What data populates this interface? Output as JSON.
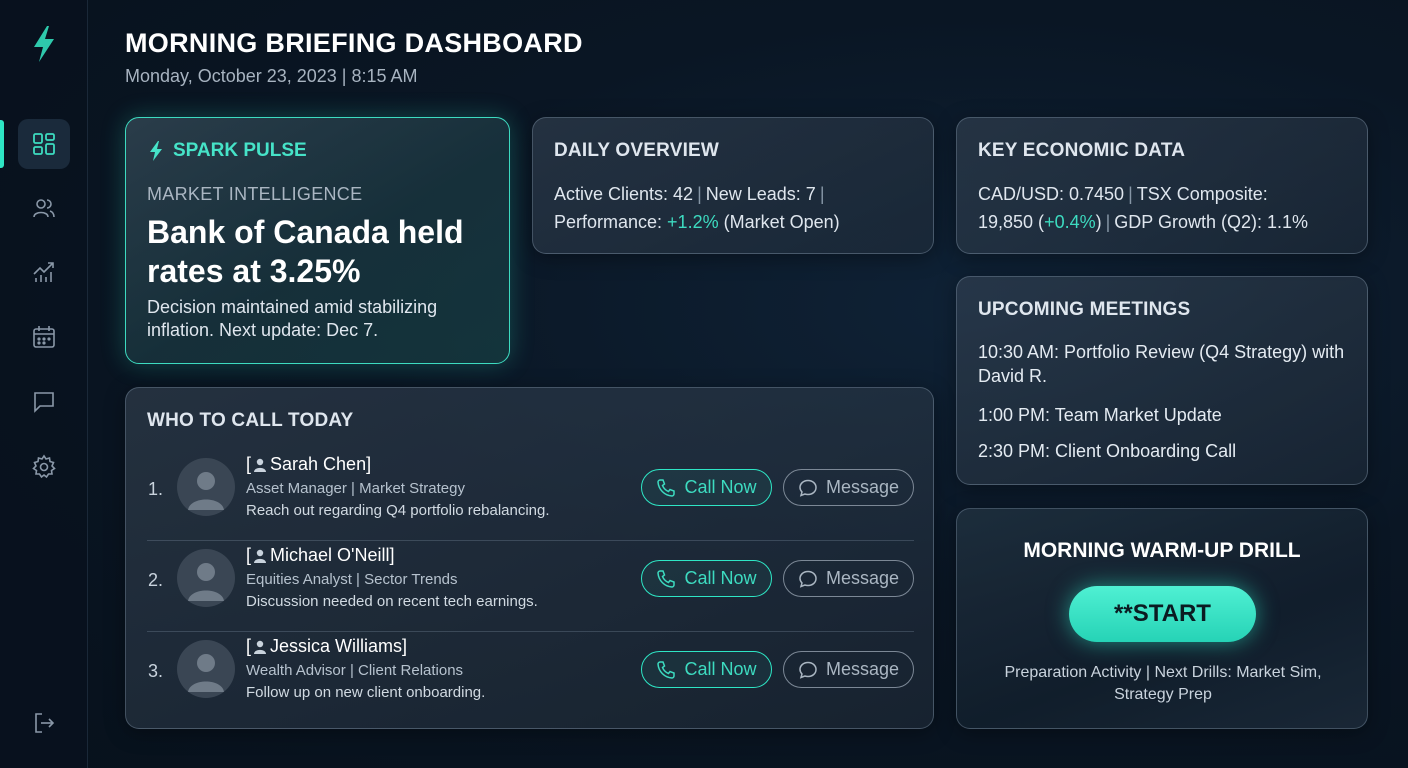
{
  "header": {
    "title": "MORNING BRIEFING DASHBOARD",
    "date": "Monday, October 23, 2023 | 8:15 AM"
  },
  "sidebar": {
    "items": [
      {
        "name": "dashboard",
        "icon": "grid-icon",
        "active": true
      },
      {
        "name": "clients",
        "icon": "users-icon",
        "active": false
      },
      {
        "name": "analytics",
        "icon": "chart-icon",
        "active": false
      },
      {
        "name": "calendar",
        "icon": "calendar-icon",
        "active": false
      },
      {
        "name": "messages",
        "icon": "chat-icon",
        "active": false
      },
      {
        "name": "settings",
        "icon": "gear-icon",
        "active": false
      },
      {
        "name": "logout",
        "icon": "logout-icon",
        "active": false
      }
    ],
    "accent": "#2ee6c5"
  },
  "spark": {
    "label": "SPARK PULSE",
    "kicker": "MARKET INTELLIGENCE",
    "headline": "Bank of Canada held rates at 3.25%",
    "body": "Decision maintained amid stabilizing inflation. Next update: Dec 7."
  },
  "overview": {
    "title": "DAILY OVERVIEW",
    "active_clients": "Active Clients: 42",
    "new_leads": "New Leads: 7",
    "performance_label": "Performance: ",
    "performance_value": "+1.2%",
    "performance_note": " (Market Open)"
  },
  "econ": {
    "title": "KEY ECONOMIC DATA",
    "cad_usd": "CAD/USD: 0.7450",
    "tsx_label": "TSX Composite:",
    "tsx_value": "19,850 (",
    "tsx_change": "+0.4%",
    "tsx_close": ")",
    "gdp": "GDP Growth (Q2): 1.1%"
  },
  "meetings": {
    "title": "UPCOMING MEETINGS",
    "items": [
      "10:30 AM: Portfolio Review (Q4 Strategy) with David R.",
      "1:00 PM: Team Market Update",
      "2:30 PM: Client Onboarding Call"
    ]
  },
  "drill": {
    "title": "MORNING WARM-UP DRILL",
    "start_label": "**START",
    "footer": "Preparation Activity | Next Drills: Market Sim, Strategy Prep"
  },
  "calls": {
    "title": "WHO TO CALL TODAY",
    "call_label": "Call Now",
    "message_label": "Message",
    "rows": [
      {
        "num": "1.",
        "name": "Sarah Chen]",
        "role": "Asset Manager | Market Strategy",
        "note": "Reach out regarding Q4 portfolio rebalancing."
      },
      {
        "num": "2.",
        "name": "Michael O'Neill]",
        "role": "Equities Analyst | Sector Trends",
        "note": "Discussion needed on recent tech earnings."
      },
      {
        "num": "3.",
        "name": "Jessica Williams]",
        "role": "Wealth Advisor | Client Relations",
        "note": "Follow up on new client onboarding."
      }
    ]
  }
}
